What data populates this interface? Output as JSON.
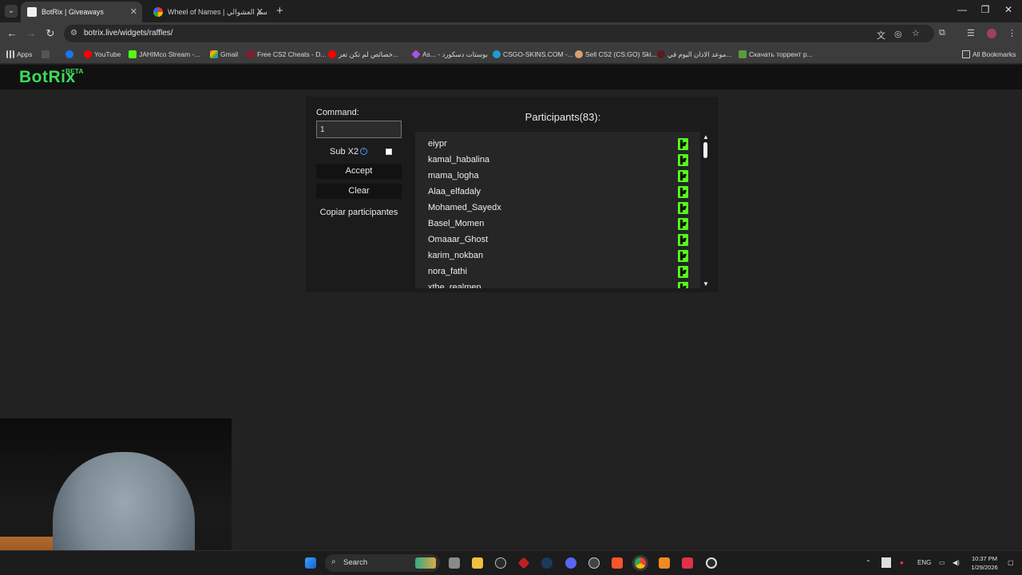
{
  "browser": {
    "tabs": [
      {
        "title": "BotRix | Giveaways",
        "active": true
      },
      {
        "title": "Wheel of Names | ﺳﻢ اﻟﻌﺸﻮاﻟﻲ",
        "active": false
      }
    ],
    "url": "botrix.live/widgets/raffles/",
    "bookmarks": [
      {
        "label": "Apps"
      },
      {
        "label": ""
      },
      {
        "label": "YouTube"
      },
      {
        "label": "JAHIMco Stream -..."
      },
      {
        "label": "Gmail"
      },
      {
        "label": "Free CS2 Cheats - D..."
      },
      {
        "label": "خصائص لم تكن تعر..."
      },
      {
        "label": "As... - بوستات دسكورد"
      },
      {
        "label": "CSGO-SKINS.COM -..."
      },
      {
        "label": "Sell CS2 (CS:GO) Ski..."
      },
      {
        "label": "موعد الاذان اليوم في..."
      },
      {
        "label": "Скачать торрент р..."
      }
    ],
    "all_bookmarks": "All Bookmarks"
  },
  "site": {
    "logo": "BotRix",
    "logo_badge": "BETA"
  },
  "raffle": {
    "command_label": "Command:",
    "command_value": "1",
    "sub_label": "Sub X2",
    "sub_checked": false,
    "accept_label": "Accept",
    "clear_label": "Clear",
    "copy_label": "Copiar participantes",
    "participants_title": "Participants(83):",
    "participants": [
      "eiypr",
      "kamal_habalina",
      "mama_logha",
      "Alaa_elfadaly",
      "Mohamed_Sayedx",
      "Basel_Momen",
      "Omaaar_Ghost",
      "karim_nokban",
      "nora_fathi",
      "xthe_realmen"
    ]
  },
  "taskbar": {
    "search_label": "Search",
    "lang": "ENG",
    "time": "10:37 PM",
    "date": "1/29/2026"
  },
  "colors": {
    "accent_green": "#3ddc5b",
    "kick_green": "#53fc18"
  }
}
